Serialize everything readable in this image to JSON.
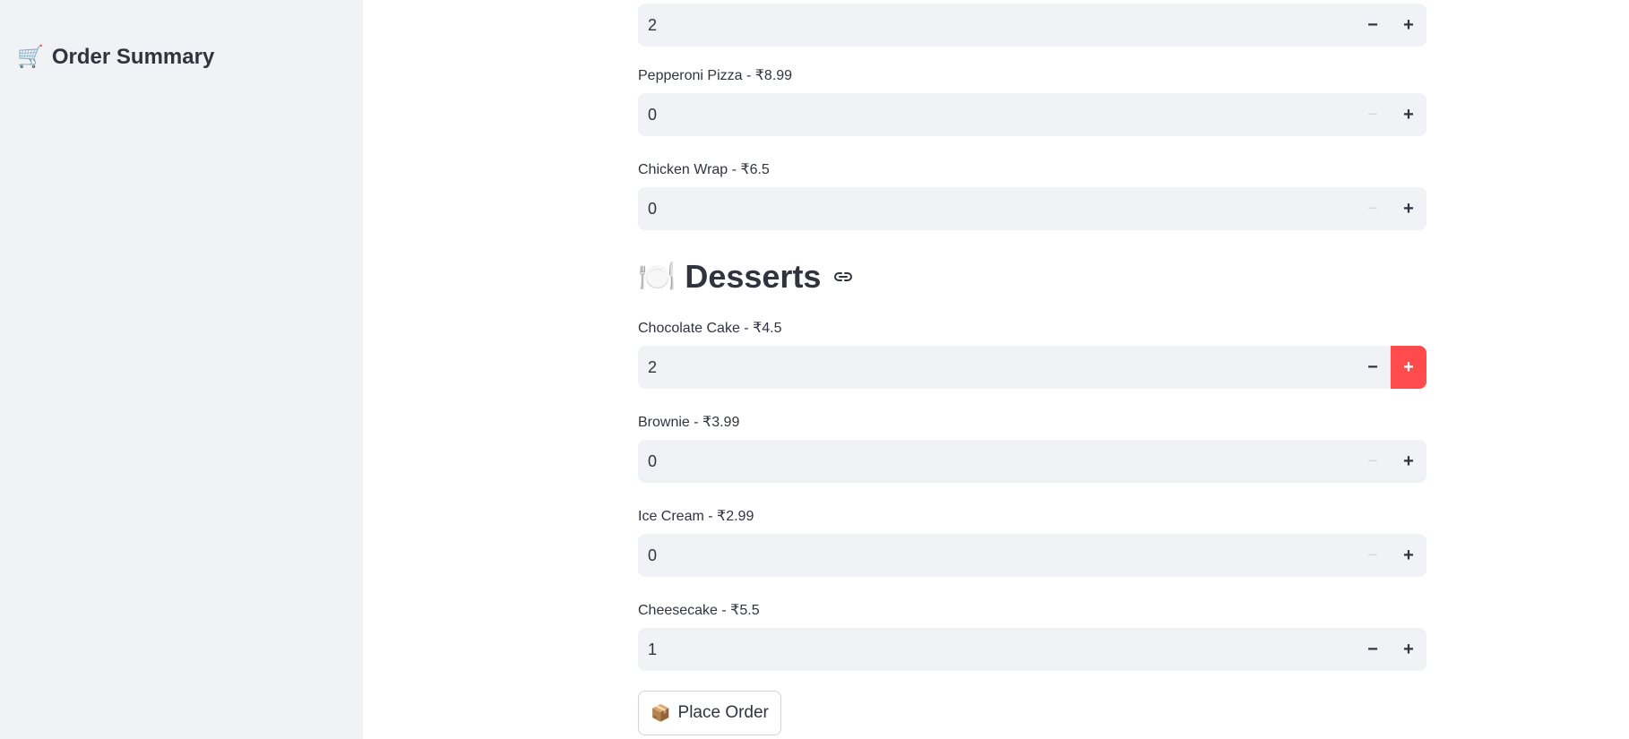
{
  "sidebar": {
    "title_icon": "🛒",
    "title": "Order Summary"
  },
  "menu": {
    "top_partial": {
      "value": "2",
      "decrement": "−",
      "increment": "+"
    },
    "items_before": [
      {
        "label": "Pepperoni Pizza - ₹8.99",
        "value": "0",
        "decrement": "−",
        "increment": "+"
      },
      {
        "label": "Chicken Wrap - ₹6.5",
        "value": "0",
        "decrement": "−",
        "increment": "+"
      }
    ],
    "section": {
      "icon": "🍽️",
      "title": "Desserts",
      "link_icon": "link-icon"
    },
    "desserts": [
      {
        "label": "Chocolate Cake - ₹4.5",
        "value": "2",
        "decrement": "−",
        "increment": "+"
      },
      {
        "label": "Brownie - ₹3.99",
        "value": "0",
        "decrement": "−",
        "increment": "+"
      },
      {
        "label": "Ice Cream - ₹2.99",
        "value": "0",
        "decrement": "−",
        "increment": "+"
      },
      {
        "label": "Cheesecake - ₹5.5",
        "value": "1",
        "decrement": "−",
        "increment": "+"
      }
    ]
  },
  "actions": {
    "place_order_icon": "📦",
    "place_order_label": "Place Order"
  },
  "colors": {
    "sidebar_bg": "#f0f2f6",
    "input_bg": "#f0f2f6",
    "accent": "#ff4b4b",
    "text": "#31333f"
  }
}
